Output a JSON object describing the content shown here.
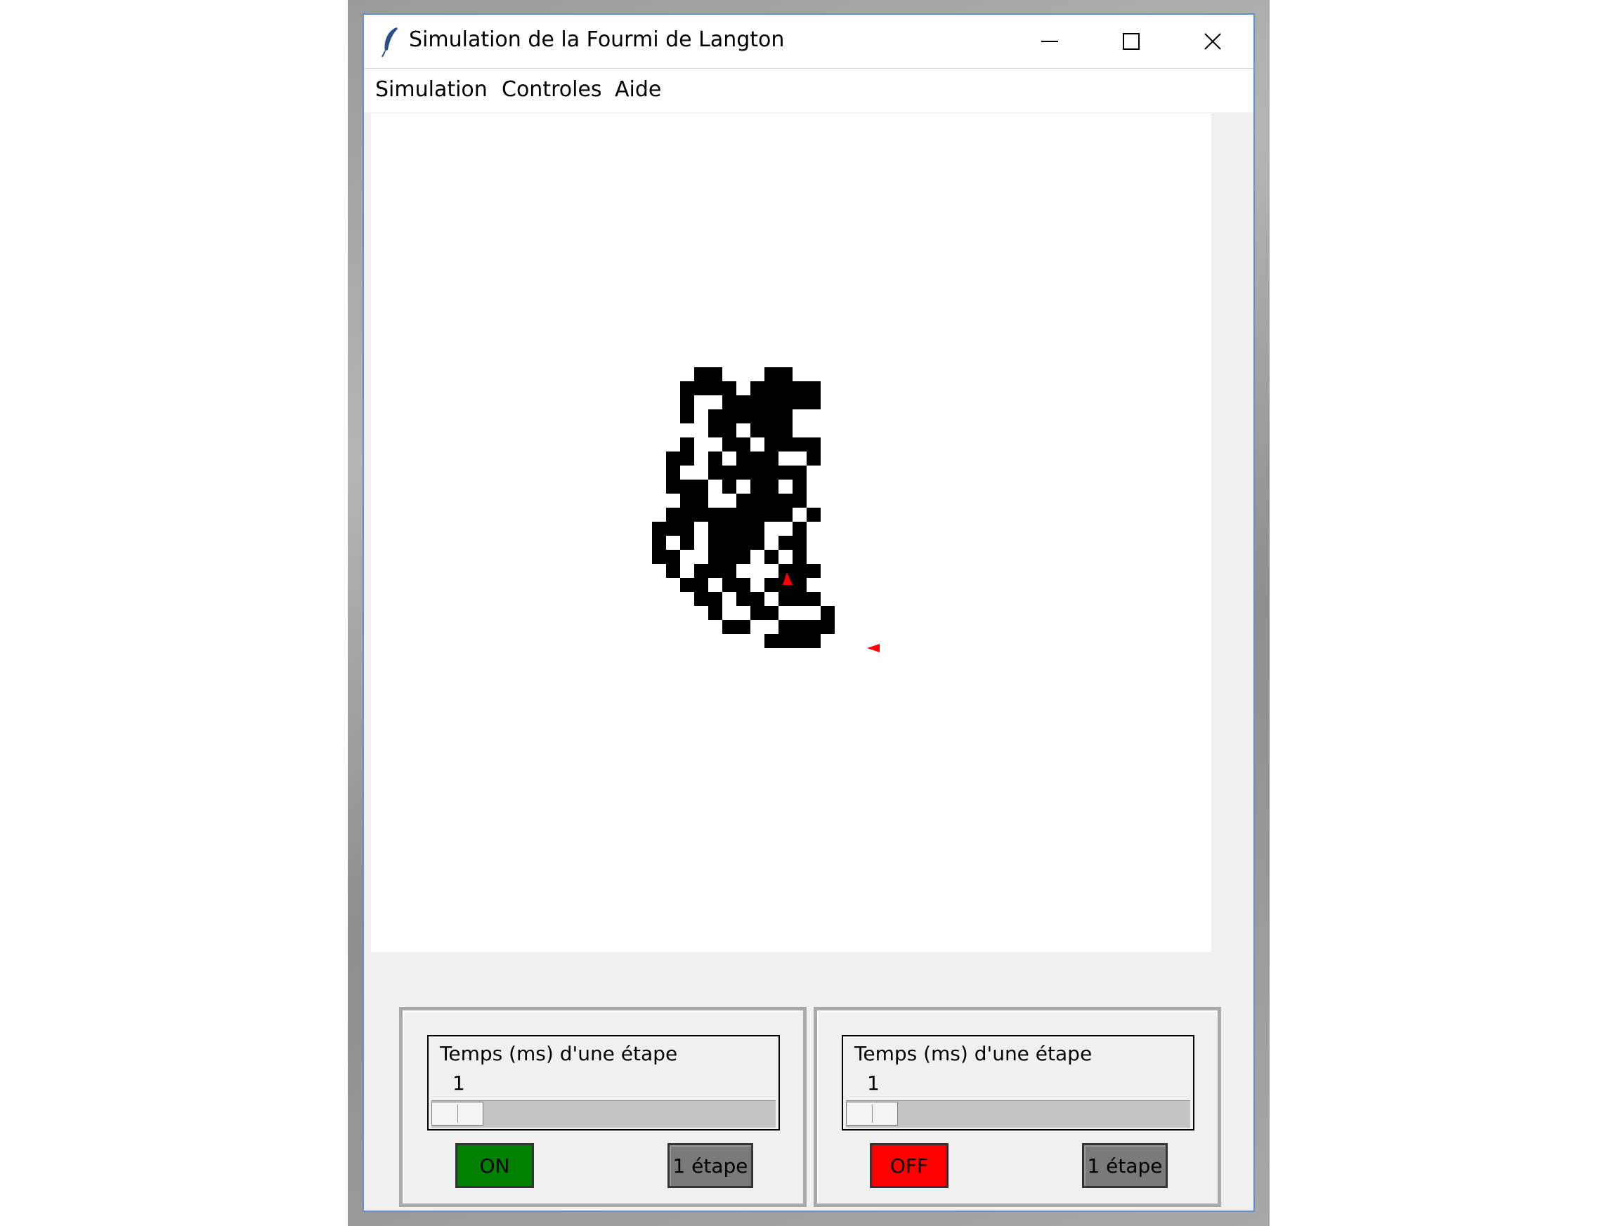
{
  "window": {
    "title": "Simulation de la Fourmi de Langton",
    "controls": {
      "minimize_icon": "minimize-icon",
      "maximize_icon": "maximize-icon",
      "close_icon": "close-icon"
    }
  },
  "menu": {
    "items": [
      "Simulation",
      "Controles",
      "Aide"
    ]
  },
  "canvas": {
    "cell_color": "#000000",
    "ant_color": "#ff0000",
    "ant_count": 2
  },
  "panels": [
    {
      "speed_label": "Temps (ms) d'une étape",
      "speed_value": "1",
      "toggle_label": "ON",
      "toggle_color": "#008000",
      "step_label": "1 étape"
    },
    {
      "speed_label": "Temps (ms) d'une étape",
      "speed_value": "1",
      "toggle_label": "OFF",
      "toggle_color": "#ff0000",
      "step_label": "1 étape"
    }
  ]
}
